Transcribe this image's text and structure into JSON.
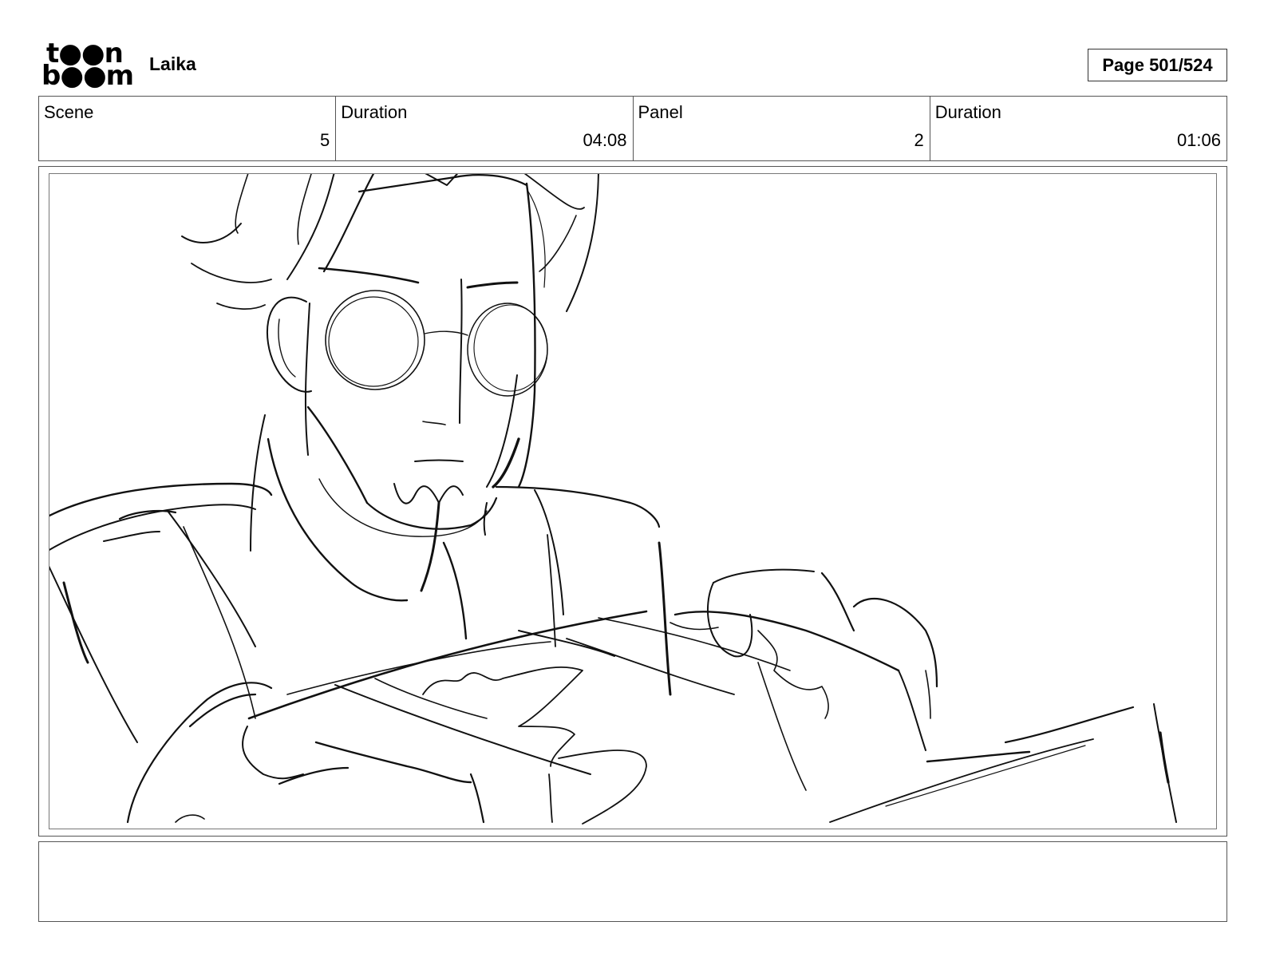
{
  "header": {
    "logo_line1": "t●●n",
    "logo_line2": "b●●m",
    "studio": "Laika",
    "page": "Page 501/524"
  },
  "info": {
    "scene_label": "Scene",
    "scene_value": "5",
    "scene_duration_label": "Duration",
    "scene_duration_value": "04:08",
    "panel_label": "Panel",
    "panel_value": "2",
    "panel_duration_label": "Duration",
    "panel_duration_value": "01:06"
  },
  "panel": {
    "image_description_icon": "sketch-drawing"
  },
  "notes": {
    "text": ""
  }
}
